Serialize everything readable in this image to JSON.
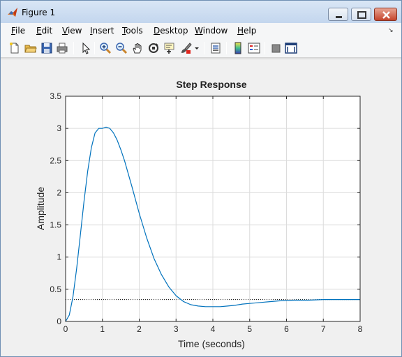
{
  "window": {
    "title": "Figure 1",
    "controls": {
      "minimize": "minimize",
      "maximize": "maximize",
      "close": "close"
    }
  },
  "menu": {
    "items": [
      "File",
      "Edit",
      "View",
      "Insert",
      "Tools",
      "Desktop",
      "Window",
      "Help"
    ],
    "dock_glyph": "↘"
  },
  "toolbar": {
    "buttons": [
      "new-figure-icon",
      "open-file-icon",
      "save-icon",
      "print-icon",
      "edit-plot-arrow-icon",
      "zoom-in-icon",
      "zoom-out-icon",
      "pan-hand-icon",
      "rotate-3d-icon",
      "data-cursor-icon",
      "brush-icon",
      "brush-dropdown-icon",
      "link-plot-icon",
      "colorbar-icon",
      "legend-icon",
      "hide-plot-tools-icon",
      "show-plot-tools-icon"
    ]
  },
  "colors": {
    "line": "#0072bd",
    "steady_state": "#000000",
    "grid": "#dcdcdc",
    "axes_bg": "#ffffff",
    "figure_bg": "#f0f0f0"
  },
  "chart_data": {
    "type": "line",
    "title": "Step Response",
    "xlabel": "Time (seconds)",
    "ylabel": "Amplitude",
    "xlim": [
      0,
      8
    ],
    "ylim": [
      0,
      3.5
    ],
    "xticks": [
      "0",
      "1",
      "2",
      "3",
      "4",
      "5",
      "6",
      "7",
      "8"
    ],
    "yticks": [
      "0",
      "0.5",
      "1",
      "1.5",
      "2",
      "2.5",
      "3",
      "3.5"
    ],
    "grid": true,
    "legend": "none",
    "series": [
      {
        "x": [
          0,
          0.1,
          0.2,
          0.3,
          0.4,
          0.5,
          0.6,
          0.7,
          0.8,
          0.9,
          1.0,
          1.1,
          1.2,
          1.3,
          1.4,
          1.5,
          1.6,
          1.8,
          2.0,
          2.2,
          2.4,
          2.6,
          2.8,
          3.0,
          3.2,
          3.4,
          3.6,
          3.8,
          4.0,
          4.2,
          4.4,
          4.6,
          4.8,
          5.0,
          5.4,
          5.8,
          6.2,
          6.6,
          7.0,
          7.4,
          8.0
        ],
        "y": [
          0,
          0.1,
          0.38,
          0.82,
          1.34,
          1.87,
          2.34,
          2.7,
          2.93,
          3.0,
          3.0,
          3.02,
          3.0,
          2.93,
          2.82,
          2.67,
          2.5,
          2.1,
          1.68,
          1.3,
          0.98,
          0.73,
          0.54,
          0.4,
          0.31,
          0.26,
          0.24,
          0.23,
          0.23,
          0.23,
          0.24,
          0.25,
          0.27,
          0.28,
          0.3,
          0.32,
          0.33,
          0.33,
          0.34,
          0.34,
          0.34
        ]
      }
    ],
    "steady_state": 0.34
  }
}
